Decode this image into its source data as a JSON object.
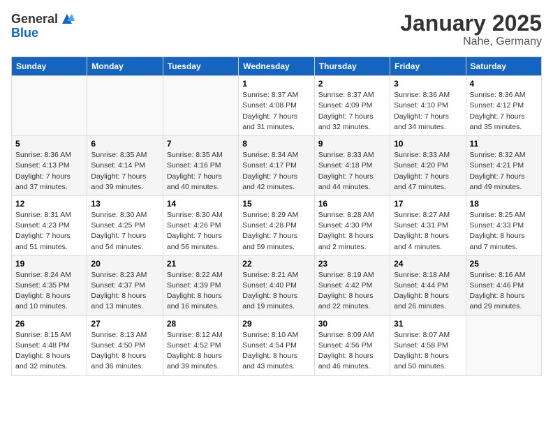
{
  "header": {
    "logo_general": "General",
    "logo_blue": "Blue",
    "month_title": "January 2025",
    "subtitle": "Nahe, Germany"
  },
  "weekdays": [
    "Sunday",
    "Monday",
    "Tuesday",
    "Wednesday",
    "Thursday",
    "Friday",
    "Saturday"
  ],
  "weeks": [
    [
      {
        "day": "",
        "info": ""
      },
      {
        "day": "",
        "info": ""
      },
      {
        "day": "",
        "info": ""
      },
      {
        "day": "1",
        "info": "Sunrise: 8:37 AM\nSunset: 4:08 PM\nDaylight: 7 hours\nand 31 minutes."
      },
      {
        "day": "2",
        "info": "Sunrise: 8:37 AM\nSunset: 4:09 PM\nDaylight: 7 hours\nand 32 minutes."
      },
      {
        "day": "3",
        "info": "Sunrise: 8:36 AM\nSunset: 4:10 PM\nDaylight: 7 hours\nand 34 minutes."
      },
      {
        "day": "4",
        "info": "Sunrise: 8:36 AM\nSunset: 4:12 PM\nDaylight: 7 hours\nand 35 minutes."
      }
    ],
    [
      {
        "day": "5",
        "info": "Sunrise: 8:36 AM\nSunset: 4:13 PM\nDaylight: 7 hours\nand 37 minutes."
      },
      {
        "day": "6",
        "info": "Sunrise: 8:35 AM\nSunset: 4:14 PM\nDaylight: 7 hours\nand 39 minutes."
      },
      {
        "day": "7",
        "info": "Sunrise: 8:35 AM\nSunset: 4:16 PM\nDaylight: 7 hours\nand 40 minutes."
      },
      {
        "day": "8",
        "info": "Sunrise: 8:34 AM\nSunset: 4:17 PM\nDaylight: 7 hours\nand 42 minutes."
      },
      {
        "day": "9",
        "info": "Sunrise: 8:33 AM\nSunset: 4:18 PM\nDaylight: 7 hours\nand 44 minutes."
      },
      {
        "day": "10",
        "info": "Sunrise: 8:33 AM\nSunset: 4:20 PM\nDaylight: 7 hours\nand 47 minutes."
      },
      {
        "day": "11",
        "info": "Sunrise: 8:32 AM\nSunset: 4:21 PM\nDaylight: 7 hours\nand 49 minutes."
      }
    ],
    [
      {
        "day": "12",
        "info": "Sunrise: 8:31 AM\nSunset: 4:23 PM\nDaylight: 7 hours\nand 51 minutes."
      },
      {
        "day": "13",
        "info": "Sunrise: 8:30 AM\nSunset: 4:25 PM\nDaylight: 7 hours\nand 54 minutes."
      },
      {
        "day": "14",
        "info": "Sunrise: 8:30 AM\nSunset: 4:26 PM\nDaylight: 7 hours\nand 56 minutes."
      },
      {
        "day": "15",
        "info": "Sunrise: 8:29 AM\nSunset: 4:28 PM\nDaylight: 7 hours\nand 59 minutes."
      },
      {
        "day": "16",
        "info": "Sunrise: 8:28 AM\nSunset: 4:30 PM\nDaylight: 8 hours\nand 2 minutes."
      },
      {
        "day": "17",
        "info": "Sunrise: 8:27 AM\nSunset: 4:31 PM\nDaylight: 8 hours\nand 4 minutes."
      },
      {
        "day": "18",
        "info": "Sunrise: 8:25 AM\nSunset: 4:33 PM\nDaylight: 8 hours\nand 7 minutes."
      }
    ],
    [
      {
        "day": "19",
        "info": "Sunrise: 8:24 AM\nSunset: 4:35 PM\nDaylight: 8 hours\nand 10 minutes."
      },
      {
        "day": "20",
        "info": "Sunrise: 8:23 AM\nSunset: 4:37 PM\nDaylight: 8 hours\nand 13 minutes."
      },
      {
        "day": "21",
        "info": "Sunrise: 8:22 AM\nSunset: 4:39 PM\nDaylight: 8 hours\nand 16 minutes."
      },
      {
        "day": "22",
        "info": "Sunrise: 8:21 AM\nSunset: 4:40 PM\nDaylight: 8 hours\nand 19 minutes."
      },
      {
        "day": "23",
        "info": "Sunrise: 8:19 AM\nSunset: 4:42 PM\nDaylight: 8 hours\nand 22 minutes."
      },
      {
        "day": "24",
        "info": "Sunrise: 8:18 AM\nSunset: 4:44 PM\nDaylight: 8 hours\nand 26 minutes."
      },
      {
        "day": "25",
        "info": "Sunrise: 8:16 AM\nSunset: 4:46 PM\nDaylight: 8 hours\nand 29 minutes."
      }
    ],
    [
      {
        "day": "26",
        "info": "Sunrise: 8:15 AM\nSunset: 4:48 PM\nDaylight: 8 hours\nand 32 minutes."
      },
      {
        "day": "27",
        "info": "Sunrise: 8:13 AM\nSunset: 4:50 PM\nDaylight: 8 hours\nand 36 minutes."
      },
      {
        "day": "28",
        "info": "Sunrise: 8:12 AM\nSunset: 4:52 PM\nDaylight: 8 hours\nand 39 minutes."
      },
      {
        "day": "29",
        "info": "Sunrise: 8:10 AM\nSunset: 4:54 PM\nDaylight: 8 hours\nand 43 minutes."
      },
      {
        "day": "30",
        "info": "Sunrise: 8:09 AM\nSunset: 4:56 PM\nDaylight: 8 hours\nand 46 minutes."
      },
      {
        "day": "31",
        "info": "Sunrise: 8:07 AM\nSunset: 4:58 PM\nDaylight: 8 hours\nand 50 minutes."
      },
      {
        "day": "",
        "info": ""
      }
    ]
  ]
}
